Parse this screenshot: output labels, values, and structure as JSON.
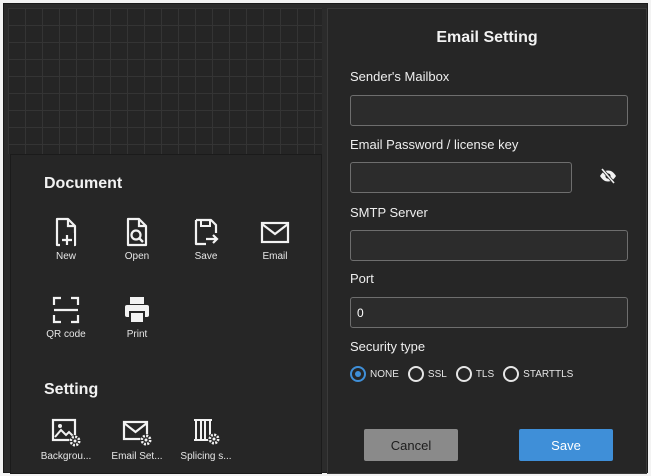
{
  "document_section": {
    "title": "Document",
    "tools": [
      {
        "label": "New",
        "icon": "file-plus-icon"
      },
      {
        "label": "Open",
        "icon": "file-search-icon"
      },
      {
        "label": "Save",
        "icon": "save-icon"
      },
      {
        "label": "Email",
        "icon": "mail-icon"
      },
      {
        "label": "QR code",
        "icon": "qr-scan-icon"
      },
      {
        "label": "Print",
        "icon": "printer-icon"
      }
    ]
  },
  "setting_section": {
    "title": "Setting",
    "tools": [
      {
        "label": "Backgrou...",
        "icon": "image-settings-icon"
      },
      {
        "label": "Email Set...",
        "icon": "mail-settings-icon"
      },
      {
        "label": "Splicing s...",
        "icon": "splicing-settings-icon"
      }
    ]
  },
  "email_setting": {
    "title": "Email Setting",
    "senders_mailbox": {
      "label": "Sender's Mailbox",
      "value": ""
    },
    "password": {
      "label": "Email Password / license key",
      "value": ""
    },
    "smtp_server": {
      "label": "SMTP Server",
      "value": ""
    },
    "port": {
      "label": "Port",
      "value": "0"
    },
    "security_type": {
      "label": "Security type",
      "options": [
        "NONE",
        "SSL",
        "TLS",
        "STARTTLS"
      ],
      "selected": "NONE"
    },
    "cancel_label": "Cancel",
    "save_label": "Save"
  },
  "colors": {
    "accent": "#3f8fd8",
    "panel": "#262626",
    "cancel_button": "#8a8a8a"
  }
}
